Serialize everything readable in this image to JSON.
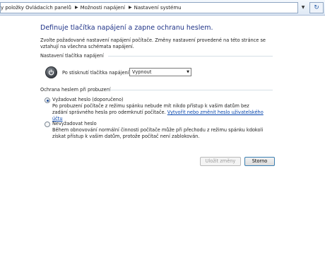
{
  "address_bar": {
    "crumbs": [
      "y položky Ovládacích panelů",
      "Možnosti napájení",
      "Nastavení systému"
    ]
  },
  "main": {
    "title": "Definuje tlačítka napájení a zapne ochranu heslem.",
    "description": "Zvolte požadované nastavení napájení počítače. Změny nastavení provedené na této stránce se vztahují na všechna schémata napájení.",
    "power_group": {
      "heading": "Nastavení tlačítka napájení",
      "row_label": "Po stisknutí tlačítka napájení:",
      "selected_value": "Vypnout"
    },
    "password_group": {
      "heading": "Ochrana heslem při probuzení",
      "options": [
        {
          "label": "Vyžadovat heslo (doporučeno)",
          "selected": true,
          "description": "Po probuzení počítače z režimu spánku nebude mít nikdo přístup k vašim datům bez zadání správného hesla pro odemknutí počítače.",
          "link": "Vytvořit nebo změnit heslo uživatelského účtu"
        },
        {
          "label": "Nevyžadovat heslo",
          "selected": false,
          "description": "Během obnovování normální činnosti počítače může při přechodu z režimu spánku kdokoli získat přístup k vašim datům, protože počítač není zablokován."
        }
      ]
    },
    "buttons": {
      "save": "Uložit změny",
      "cancel": "Storno"
    }
  },
  "colors": {
    "title": "#1e3287",
    "link": "#0645ad",
    "group_line": "#d5dfe5"
  }
}
